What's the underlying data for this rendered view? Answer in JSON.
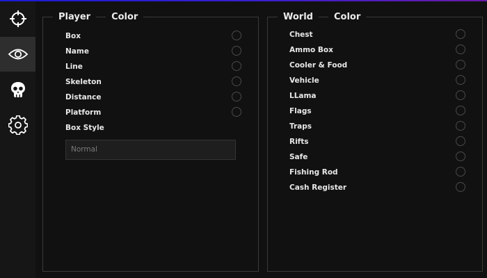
{
  "colors": {
    "accent_start": "#1b1bd6",
    "accent_end": "#6a1aa8",
    "background": "#111111",
    "active_nav": "#2e2e2e"
  },
  "sidebar": {
    "items": [
      {
        "icon": "crosshair-icon",
        "active": false
      },
      {
        "icon": "eye-icon",
        "active": true
      },
      {
        "icon": "skull-icon",
        "active": false
      },
      {
        "icon": "gear-icon",
        "active": false
      }
    ]
  },
  "player_panel": {
    "title": "Player",
    "color_label": "Color",
    "options": [
      {
        "label": "Box"
      },
      {
        "label": "Name"
      },
      {
        "label": "Line"
      },
      {
        "label": "Skeleton"
      },
      {
        "label": "Distance"
      },
      {
        "label": "Platform"
      }
    ],
    "box_style": {
      "label": "Box Style",
      "value": "Normal"
    }
  },
  "world_panel": {
    "title": "World",
    "color_label": "Color",
    "options": [
      {
        "label": "Chest"
      },
      {
        "label": "Ammo Box"
      },
      {
        "label": "Cooler & Food"
      },
      {
        "label": "Vehicle"
      },
      {
        "label": "LLama"
      },
      {
        "label": "Flags"
      },
      {
        "label": "Traps"
      },
      {
        "label": "Rifts"
      },
      {
        "label": "Safe"
      },
      {
        "label": "Fishing Rod"
      },
      {
        "label": "Cash Register"
      }
    ]
  }
}
